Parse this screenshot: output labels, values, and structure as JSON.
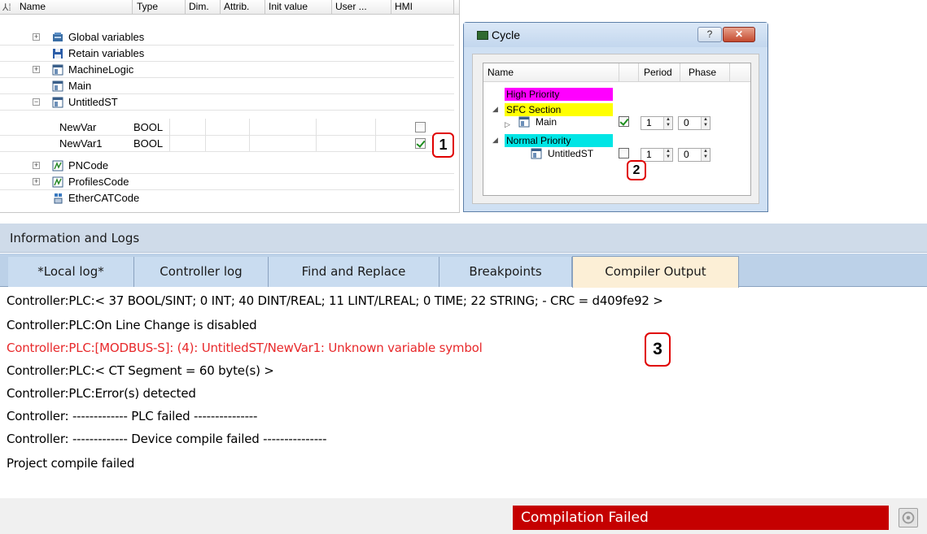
{
  "vargrid": {
    "columns": [
      "Name",
      "Type",
      "Dim.",
      "Attrib.",
      "Init value",
      "User ...",
      "HMI"
    ],
    "rows": [
      {
        "expander": "+",
        "icon": "global-variables-icon",
        "name": "Global variables"
      },
      {
        "expander": "",
        "icon": "retain-variables-icon",
        "name": "Retain variables"
      },
      {
        "expander": "+",
        "icon": "program-icon",
        "name": "MachineLogic"
      },
      {
        "expander": "",
        "icon": "program-icon",
        "name": "Main"
      },
      {
        "expander": "−",
        "icon": "program-icon",
        "name": "UntitledST"
      },
      {
        "name": "NewVar",
        "type": "BOOL",
        "hmi_checked": false
      },
      {
        "name": "NewVar1",
        "type": "BOOL",
        "hmi_checked": true
      },
      {
        "expander": "+",
        "icon": "axis-program-icon",
        "name": "PNCode"
      },
      {
        "expander": "+",
        "icon": "axis-program-icon",
        "name": "ProfilesCode"
      },
      {
        "expander": "",
        "icon": "ethercat-icon",
        "name": "EtherCATCode"
      }
    ],
    "callout": "1"
  },
  "cycle_dialog": {
    "title": "Cycle",
    "help_glyph": "?",
    "close_glyph": "✕",
    "columns": {
      "name": "Name",
      "period": "Period",
      "phase": "Phase"
    },
    "sections": [
      {
        "label": "High Priority",
        "color": "#ff00ff"
      },
      {
        "label": "SFC Section",
        "color": "#ffff00"
      },
      {
        "label": "Normal Priority",
        "color": "#00e5e5"
      }
    ],
    "programs": [
      {
        "name": "Main",
        "checked": true,
        "period": "1",
        "phase": "0"
      },
      {
        "name": "UntitledST",
        "checked": false,
        "period": "1",
        "phase": "0"
      }
    ],
    "callout": "2"
  },
  "info_panel": {
    "title": "Information and Logs",
    "tabs": [
      "*Local log*",
      "Controller log",
      "Find and Replace",
      "Breakpoints",
      "Compiler Output"
    ],
    "active_tab": "Compiler Output",
    "log_lines": [
      {
        "text": "Controller:PLC:< 37 BOOL/SINT; 0 INT; 40 DINT/REAL; 11 LINT/LREAL; 0 TIME; 22 STRING;  - CRC = d409fe92 >",
        "error": false
      },
      {
        "text": "Controller:PLC:On Line Change is disabled",
        "error": false
      },
      {
        "text": "Controller:PLC:[MODBUS-S]: (4): UntitledST/NewVar1: Unknown variable symbol",
        "error": true
      },
      {
        "text": "Controller:PLC:< CT Segment = 60 byte(s) >",
        "error": false
      },
      {
        "text": "Controller:PLC:Error(s) detected",
        "error": false
      },
      {
        "text": "Controller: ------------- PLC failed ---------------",
        "error": false
      },
      {
        "text": "Controller: ------------- Device compile failed ---------------",
        "error": false
      },
      {
        "text": "Project compile failed",
        "error": false
      }
    ],
    "callout": "3",
    "status": "Compilation Failed",
    "status_color": "#c50000",
    "error_text_color": "#e8292b"
  }
}
